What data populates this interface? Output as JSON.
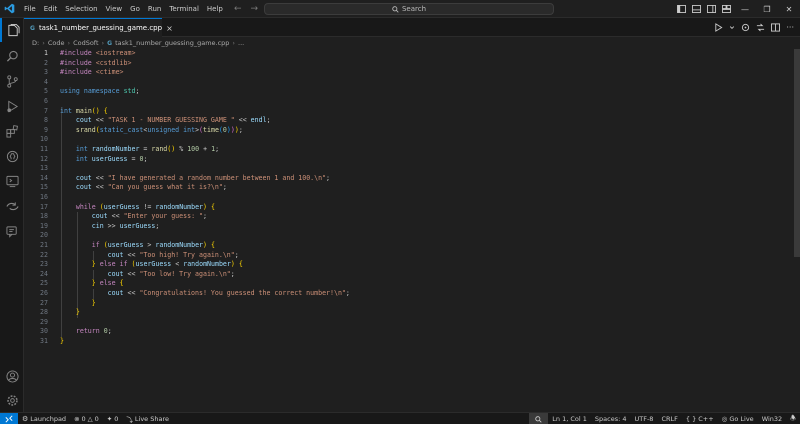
{
  "menu": [
    "File",
    "Edit",
    "Selection",
    "View",
    "Go",
    "Run",
    "Terminal",
    "Help"
  ],
  "search": {
    "label": "Search"
  },
  "tab": {
    "filename": "task1_number_guessing_game.cpp",
    "lang_badge": "G"
  },
  "breadcrumb": {
    "drive": "D:",
    "folder1": "Code",
    "folder2": "CodSoft",
    "file": "task1_number_guessing_game.cpp",
    "ellipsis": "..."
  },
  "editor": {
    "active_line": 1,
    "lines": [
      "#include <iostream>",
      "#include <cstdlib>",
      "#include <ctime>",
      "",
      "using namespace std;",
      "",
      "int main() {",
      "    cout << \"TASK 1 - NUMBER GUESSING GAME \" << endl;",
      "    srand(static_cast<unsigned int>(time(0)));",
      "",
      "    int randomNumber = rand() % 100 + 1;",
      "    int userGuess = 0;",
      "",
      "    cout << \"I have generated a random number between 1 and 100.\\n\";",
      "    cout << \"Can you guess what it is?\\n\";",
      "",
      "    while (userGuess != randomNumber) {",
      "        cout << \"Enter your guess: \";",
      "        cin >> userGuess;",
      "",
      "        if (userGuess > randomNumber) {",
      "            cout << \"Too high! Try again.\\n\";",
      "        } else if (userGuess < randomNumber) {",
      "            cout << \"Too low! Try again.\\n\";",
      "        } else {",
      "            cout << \"Congratulations! You guessed the correct number!\\n\";",
      "        }",
      "    }",
      "",
      "    return 0;",
      "}"
    ]
  },
  "statusbar": {
    "launchpad": "Launchpad",
    "errors": "0",
    "warnings": "0",
    "ports": "0",
    "live_share": "Live Share",
    "position": "Ln 1, Col 1",
    "spaces": "Spaces: 4",
    "encoding": "UTF-8",
    "eol": "CRLF",
    "language": "C++",
    "go_live": "Go Live",
    "platform": "Win32"
  },
  "colors": {
    "accent": "#0078d4",
    "background": "#1f1f1f",
    "activity_bar": "#181818"
  }
}
